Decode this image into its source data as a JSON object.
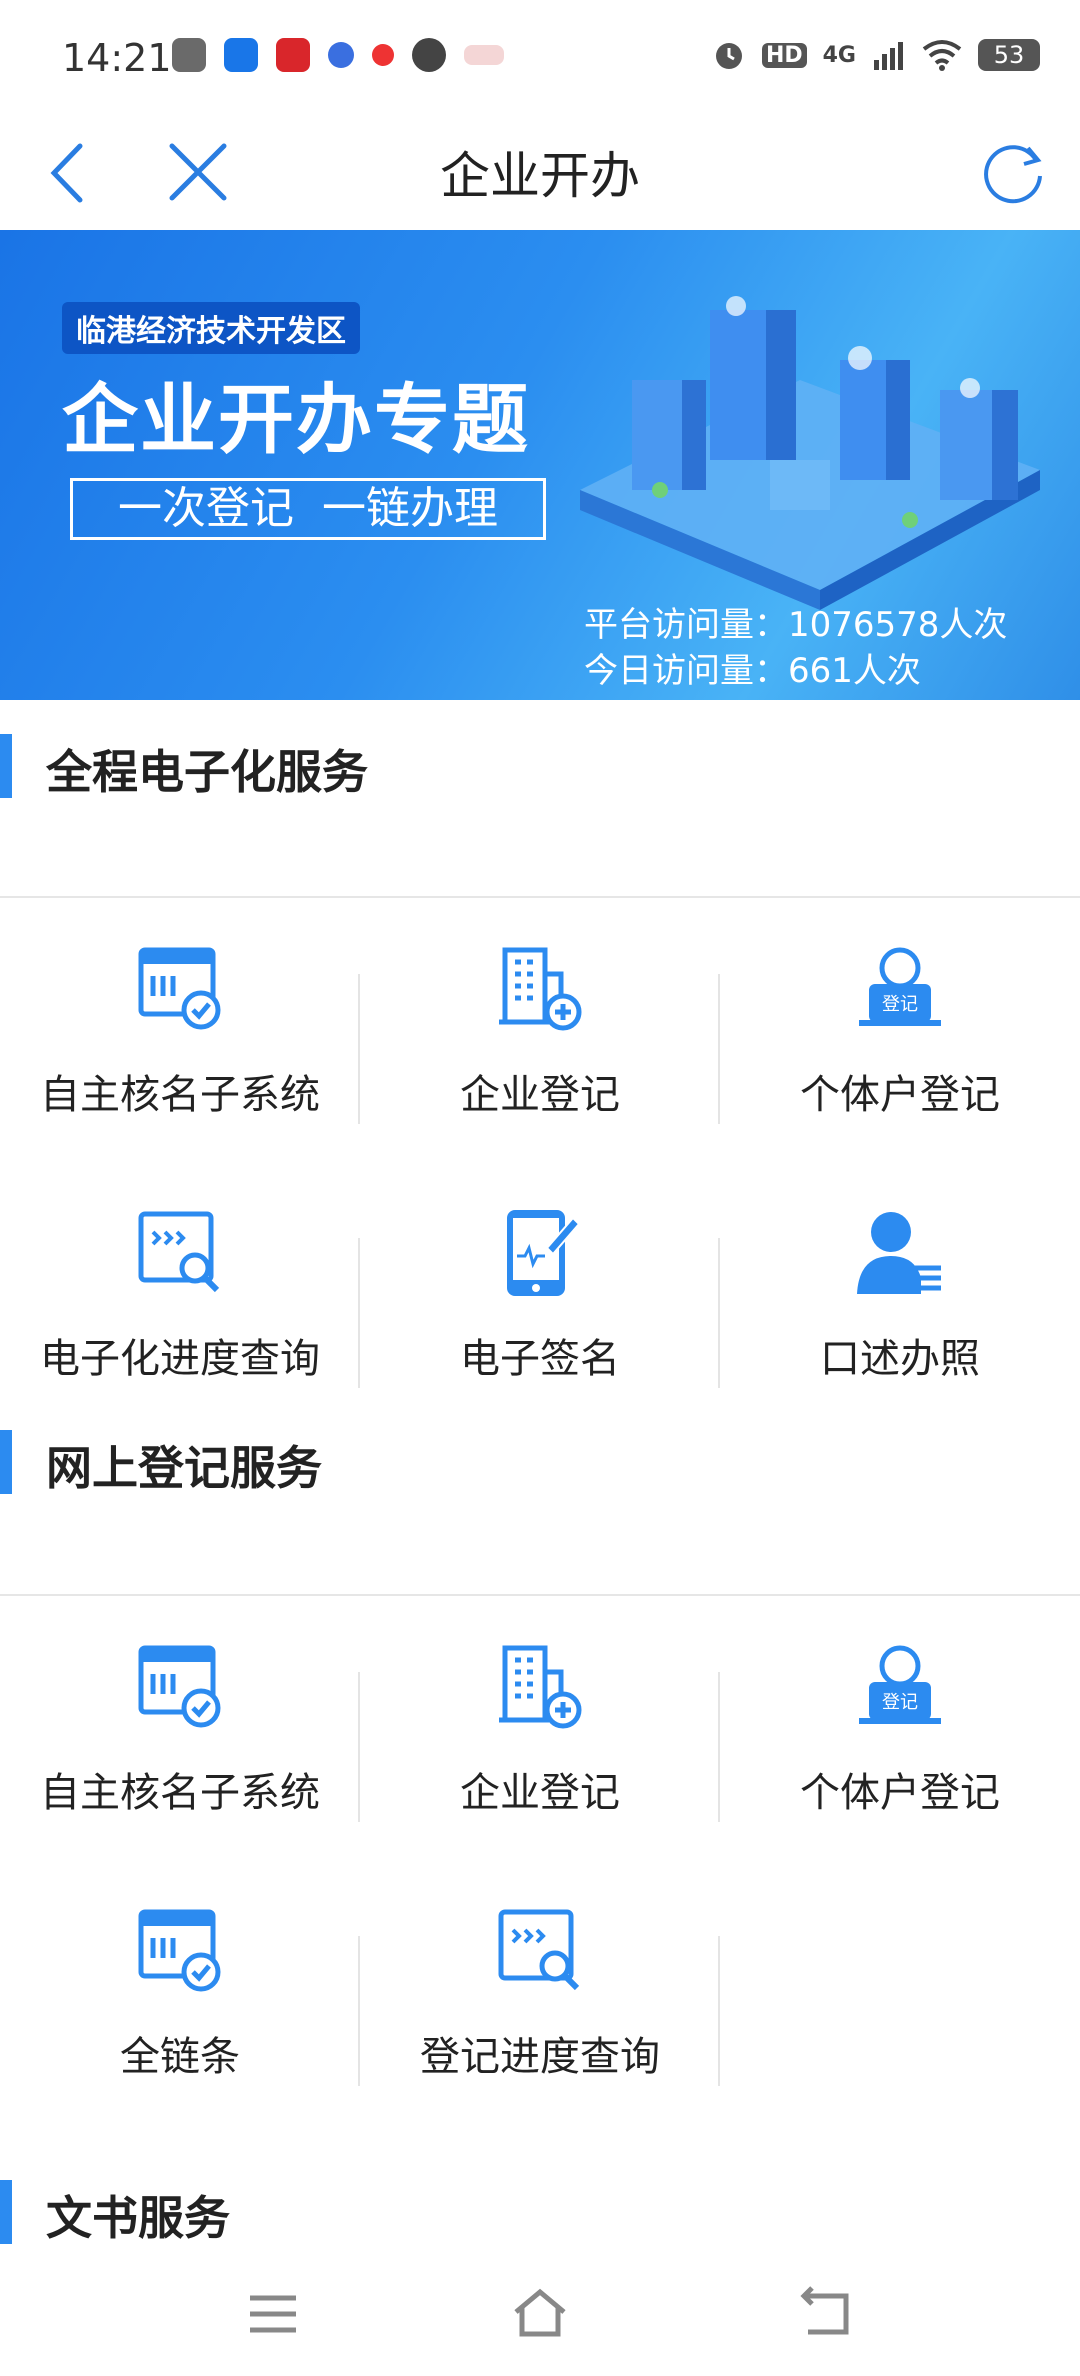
{
  "status_bar": {
    "time": "14:21",
    "network": "4G",
    "hd": "HD",
    "battery": "53"
  },
  "nav": {
    "title": "企业开办",
    "icons": [
      "back-icon",
      "close-icon",
      "refresh-icon"
    ]
  },
  "banner": {
    "subtitle": "临港经济技术开发区",
    "title": "企业开办专题",
    "slogan": "一次登记  一链办理",
    "stats": {
      "platform_visits": "平台访问量：1076578人次",
      "today_visits": "今日访问量：661人次"
    }
  },
  "sections": [
    {
      "title": "全程电子化服务",
      "items": [
        {
          "label": "自主核名子系统",
          "icon": "name-check-icon"
        },
        {
          "label": "企业登记",
          "icon": "building-add-icon"
        },
        {
          "label": "个体户登记",
          "icon": "person-register-icon"
        },
        {
          "label": "电子化进度查询",
          "icon": "progress-search-icon"
        },
        {
          "label": "电子签名",
          "icon": "tablet-sign-icon"
        },
        {
          "label": "口述办照",
          "icon": "person-speak-icon"
        }
      ]
    },
    {
      "title": "网上登记服务",
      "items": [
        {
          "label": "自主核名子系统",
          "icon": "name-check-icon"
        },
        {
          "label": "企业登记",
          "icon": "building-add-icon"
        },
        {
          "label": "个体户登记",
          "icon": "person-register-icon"
        },
        {
          "label": "全链条",
          "icon": "name-check-icon"
        },
        {
          "label": "登记进度查询",
          "icon": "progress-search-icon"
        }
      ]
    },
    {
      "title": "文书服务",
      "items": []
    }
  ],
  "register_badge": "登记",
  "colors": {
    "accent": "#2c8bf0",
    "banner": "#1a74e6"
  }
}
